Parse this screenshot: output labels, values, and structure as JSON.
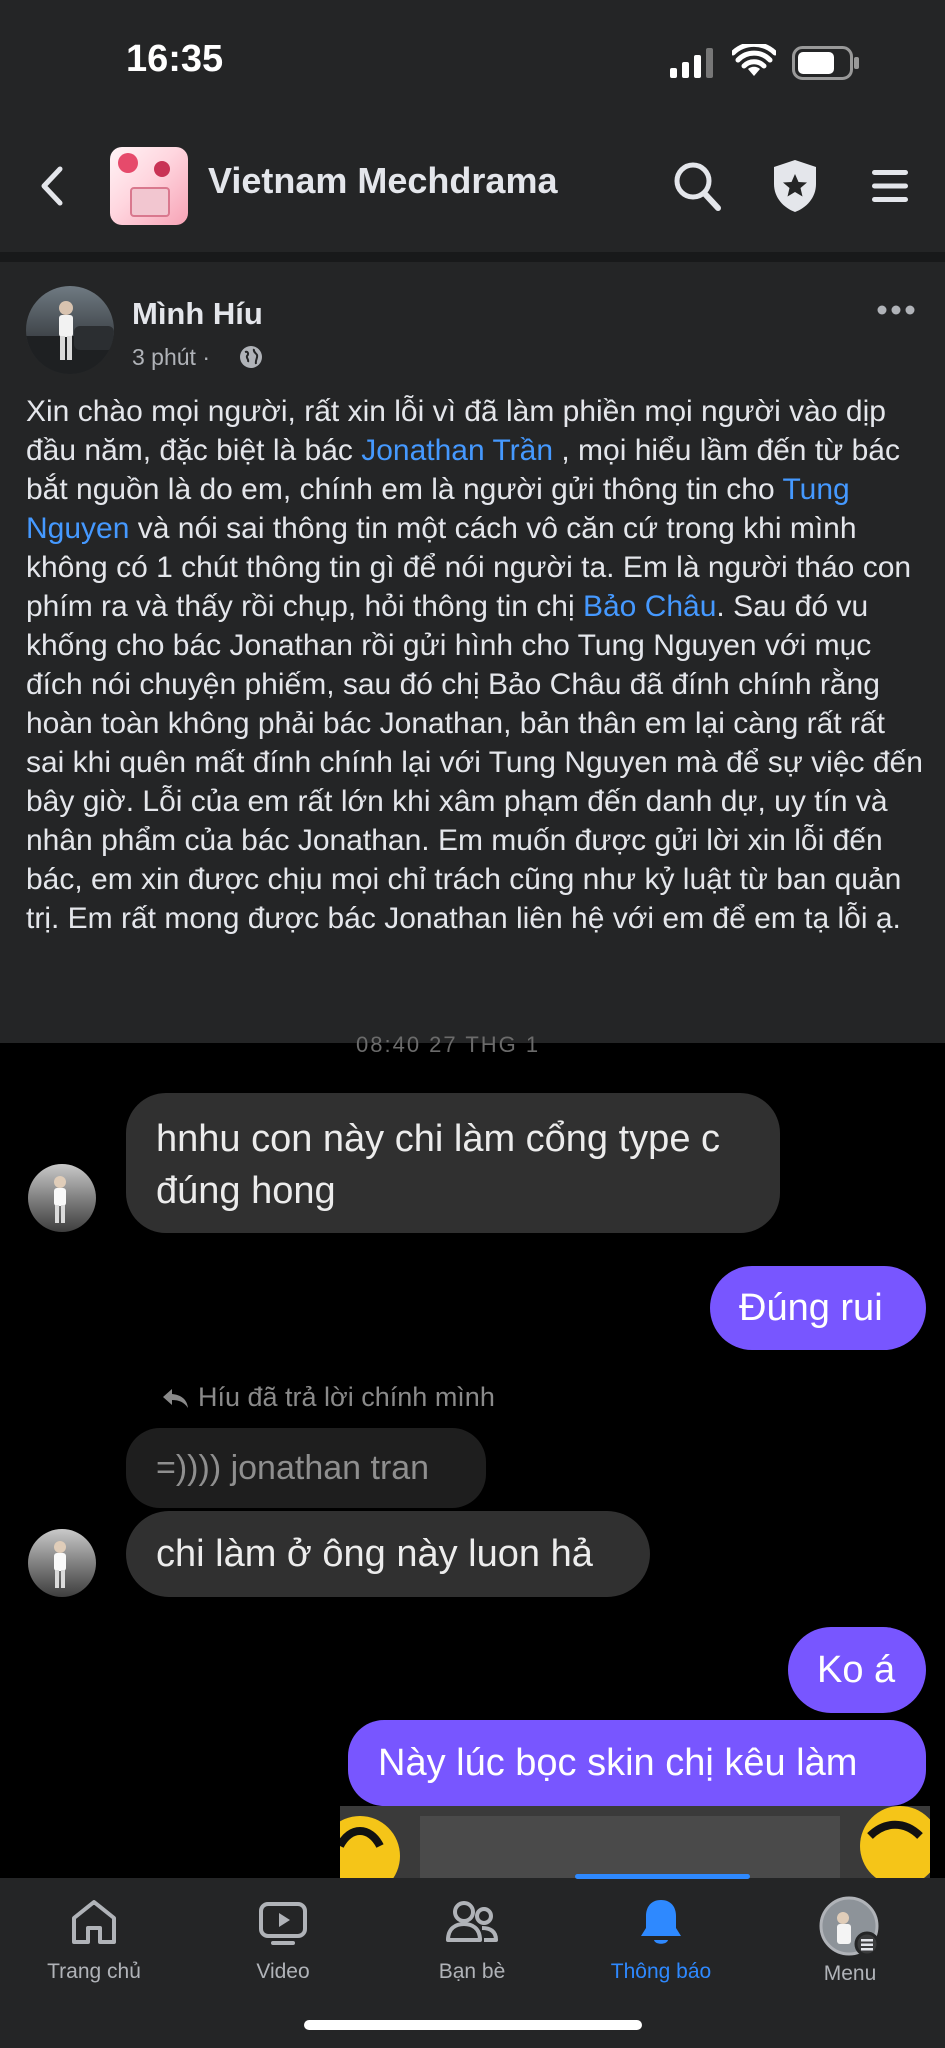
{
  "status_bar": {
    "time": "16:35"
  },
  "header": {
    "title": "Vietnam Mechdrama"
  },
  "post": {
    "author": "Mình Híu",
    "time": "3 phút",
    "meta_sep": "·",
    "segments": [
      {
        "t": "Xin chào mọi người, rất xin lỗi vì đã làm phiền mọi người vào dịp đầu năm, đặc biệt là bác "
      },
      {
        "t": "Jonathan Trần",
        "link": true
      },
      {
        "t": " , mọi hiểu lầm đến từ bác bắt nguồn là do em, chính em là người gửi thông tin cho "
      },
      {
        "t": "Tung Nguyen",
        "link": true
      },
      {
        "t": " và nói sai thông tin một cách vô căn cứ trong khi mình không có 1 chút thông tin gì để nói người ta. Em là người tháo con phím ra và thấy rồi chụp, hỏi thông tin chị "
      },
      {
        "t": "Bảo Châu",
        "link": true
      },
      {
        "t": ". Sau đó vu khống cho bác Jonathan rồi gửi hình cho Tung Nguyen với mục đích nói chuyện phiếm, sau đó chị Bảo Châu đã đính chính rằng hoàn toàn không phải bác Jonathan, bản thân em lại càng rất rất sai khi quên mất đính chính lại với Tung Nguyen mà để sự việc đến bây giờ. Lỗi của em rất lớn khi xâm phạm đến danh dự, uy tín và nhân phẩm của bác Jonathan. Em muốn được gửi lời xin lỗi đến bác, em xin được chịu mọi chỉ trách cũng như kỷ luật từ ban quản trị. Em rất mong được bác Jonathan liên hệ với em để em tạ lỗi ạ."
      }
    ]
  },
  "chat": {
    "cut_timestamp": "08:40 27 THG 1",
    "msg_in_1": "hnhu con này chi làm cổng type c đúng hong",
    "msg_out_1": "Đúng rui",
    "reply_label": "Híu đã trả lời chính mình",
    "quoted": "=)))) jonathan tran",
    "msg_in_2": "chi làm ở ông này luon hả",
    "msg_out_2": "Ko á",
    "msg_out_3": "Này lúc bọc skin chị kêu làm"
  },
  "nav": {
    "home": "Trang chủ",
    "video": "Video",
    "friends": "Bạn bè",
    "notifications": "Thông báo",
    "menu": "Menu",
    "active_color": "#2e89ff"
  }
}
